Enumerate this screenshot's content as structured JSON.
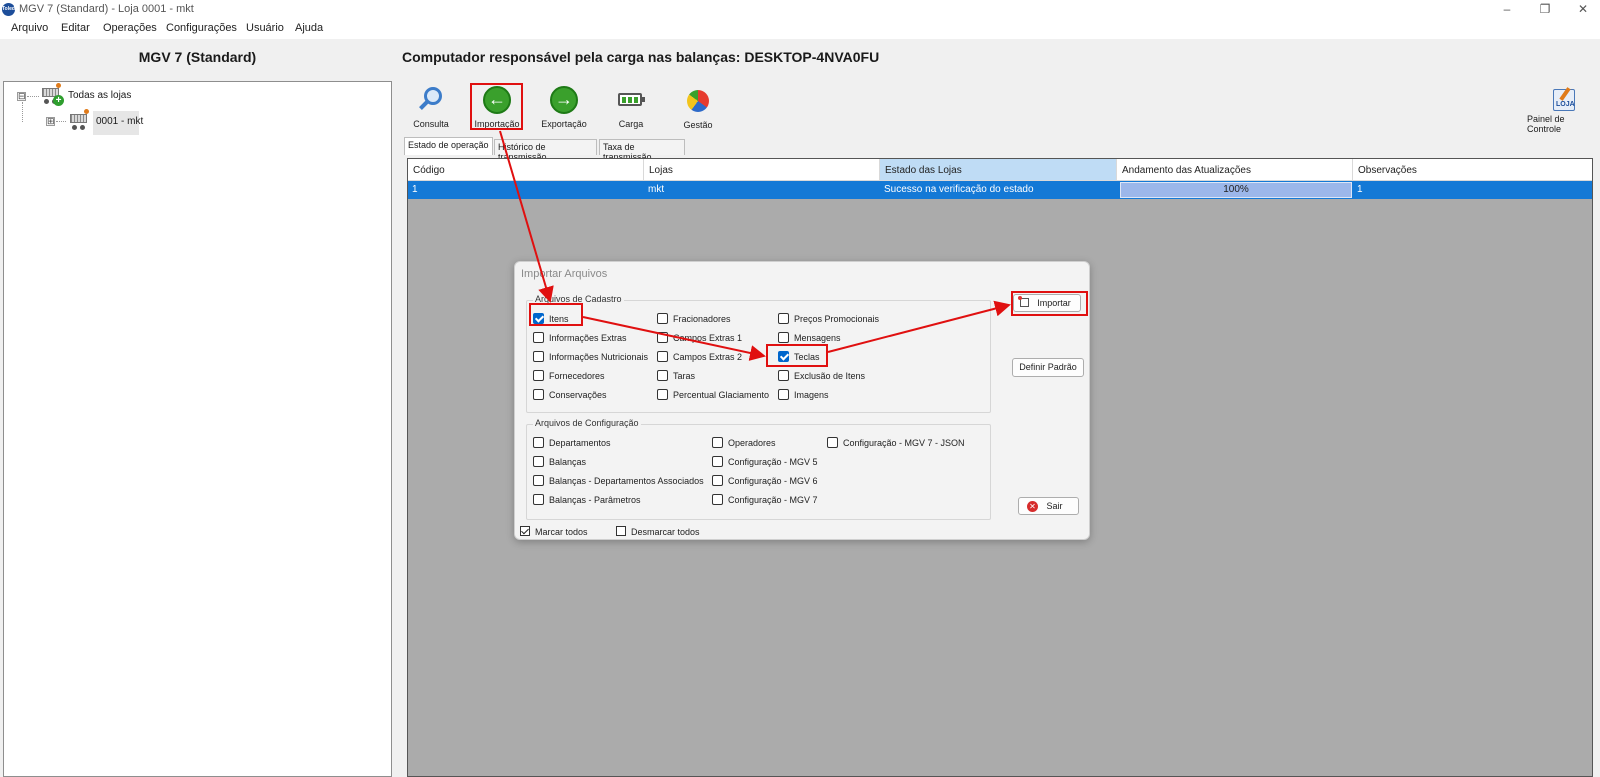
{
  "window": {
    "title": "MGV 7 (Standard) - Loja 0001 - mkt",
    "app_icon": "Toledo",
    "controls": [
      "minimize-icon",
      "restore-icon",
      "close-icon"
    ]
  },
  "menu": [
    "Arquivo",
    "Editar",
    "Operações",
    "Configurações",
    "Usuário",
    "Ajuda"
  ],
  "left_panel": {
    "title": "MGV 7 (Standard)",
    "tree": [
      {
        "label": "Todas as lojas",
        "icon": "cart-add-icon",
        "expander": "⊟"
      },
      {
        "label": "0001 - mkt",
        "icon": "cart-icon",
        "expander": "⊞"
      }
    ]
  },
  "main": {
    "title": "Computador responsável pela carga nas balanças: DESKTOP-4NVA0FU",
    "toolbar": [
      {
        "label": "Consulta",
        "icon": "magnifier-icon"
      },
      {
        "label": "Importação",
        "icon": "arrow-left-green-icon"
      },
      {
        "label": "Exportação",
        "icon": "arrow-right-green-icon"
      },
      {
        "label": "Carga",
        "icon": "battery-icon"
      },
      {
        "label": "Gestão",
        "icon": "pie-chart-icon"
      }
    ],
    "control_panel": {
      "badge": "LOJA",
      "label": "Painel de Controle"
    },
    "tabs": [
      "Estado de operação",
      "Histórico de transmissão",
      "Taxa de transmissão"
    ],
    "grid": {
      "columns": [
        "Código",
        "Lojas",
        "Estado das Lojas",
        "Andamento das Atualizações",
        "Observações"
      ],
      "rows": [
        {
          "codigo": "1",
          "lojas": "mkt",
          "estado": "Sucesso na verificação do estado",
          "andamento": "100%",
          "observacoes": "1"
        }
      ]
    }
  },
  "dialog": {
    "title": "Importar Arquivos",
    "cadastro": {
      "label": "Arquivos de Cadastro",
      "items": [
        {
          "label": "Itens",
          "checked": true
        },
        {
          "label": "Informações Extras",
          "checked": false
        },
        {
          "label": "Informações Nutricionais",
          "checked": false
        },
        {
          "label": "Fornecedores",
          "checked": false
        },
        {
          "label": "Conservações",
          "checked": false
        },
        {
          "label": "Fracionadores",
          "checked": false
        },
        {
          "label": "Campos Extras 1",
          "checked": false
        },
        {
          "label": "Campos Extras 2",
          "checked": false
        },
        {
          "label": "Taras",
          "checked": false
        },
        {
          "label": "Percentual Glaciamento",
          "checked": false
        },
        {
          "label": "Preços Promocionais",
          "checked": false
        },
        {
          "label": "Mensagens",
          "checked": false
        },
        {
          "label": "Teclas",
          "checked": true
        },
        {
          "label": "Exclusão de Itens",
          "checked": false
        },
        {
          "label": "Imagens",
          "checked": false
        }
      ]
    },
    "configuracao": {
      "label": "Arquivos de Configuração",
      "items": [
        {
          "label": "Departamentos",
          "checked": false
        },
        {
          "label": "Balanças",
          "checked": false
        },
        {
          "label": "Balanças - Departamentos Associados",
          "checked": false
        },
        {
          "label": "Balanças - Parâmetros",
          "checked": false
        },
        {
          "label": "Operadores",
          "checked": false
        },
        {
          "label": "Configuração - MGV 5",
          "checked": false
        },
        {
          "label": "Configuração - MGV 6",
          "checked": false
        },
        {
          "label": "Configuração - MGV 7",
          "checked": false
        },
        {
          "label": "Configuração - MGV 7 - JSON",
          "checked": false
        }
      ]
    },
    "buttons": {
      "importar": "Importar",
      "definir_padrao": "Definir Padrão",
      "sair": "Sair"
    },
    "footer": {
      "marcar_todos": "Marcar todos",
      "desmarcar_todos": "Desmarcar todos"
    }
  },
  "annotation_color": "#e01010"
}
